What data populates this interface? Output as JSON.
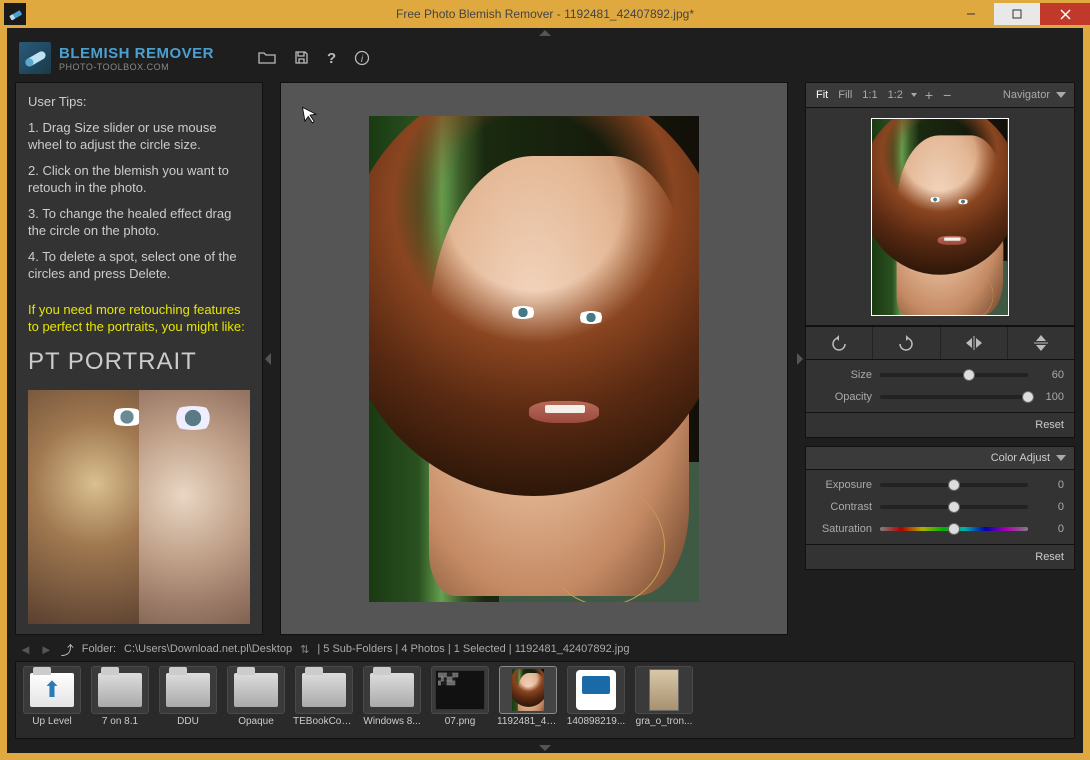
{
  "window": {
    "title": "Free Photo Blemish Remover - 1192481_42407892.jpg*"
  },
  "branding": {
    "name": "BLEMISH REMOVER",
    "sub": "PHOTO-TOOLBOX.COM"
  },
  "header_tools": {
    "open": "open-icon",
    "save": "save-icon",
    "help": "?",
    "info": "ⓘ"
  },
  "tips": {
    "heading": "User Tips:",
    "items": [
      "1. Drag Size slider or use mouse wheel to adjust the circle size.",
      "2. Click on the blemish you want to retouch in the photo.",
      "3. To change the healed effect drag the circle on the photo.",
      "4. To delete a spot, select one of the circles and press Delete."
    ],
    "promo_intro": "If you need more retouching features to perfect the portraits, you might like:",
    "promo_title": "PT PORTRAIT"
  },
  "navigator": {
    "title": "Navigator",
    "zoom_modes": [
      "Fit",
      "Fill",
      "1:1",
      "1:2"
    ],
    "active_mode": "Fit",
    "plus": "+",
    "minus": "−"
  },
  "tool_sliders": {
    "size": {
      "label": "Size",
      "value": 60,
      "min": 0,
      "max": 100
    },
    "opacity": {
      "label": "Opacity",
      "value": 100,
      "min": 0,
      "max": 100
    },
    "reset": "Reset"
  },
  "color_adjust": {
    "title": "Color Adjust",
    "exposure": {
      "label": "Exposure",
      "value": 0,
      "min": -100,
      "max": 100
    },
    "contrast": {
      "label": "Contrast",
      "value": 0,
      "min": -100,
      "max": 100
    },
    "saturation": {
      "label": "Saturation",
      "value": 0,
      "min": -100,
      "max": 100
    },
    "reset": "Reset"
  },
  "pathbar": {
    "folder_label": "Folder:",
    "path": "C:\\Users\\Download.net.pl\\Desktop",
    "summary": "| 5 Sub-Folders | 4 Photos | 1 Selected | 1192481_42407892.jpg"
  },
  "thumbnails": [
    {
      "label": "Up Level",
      "kind": "up"
    },
    {
      "label": "7 on 8.1",
      "kind": "folder"
    },
    {
      "label": "DDU",
      "kind": "folder"
    },
    {
      "label": "Opaque",
      "kind": "folder"
    },
    {
      "label": "TEBookCon...",
      "kind": "folder"
    },
    {
      "label": "Windows 8...",
      "kind": "folder"
    },
    {
      "label": "07.png",
      "kind": "image-dark"
    },
    {
      "label": "1192481_42...",
      "kind": "image-photo",
      "selected": true
    },
    {
      "label": "140898219...",
      "kind": "image-scanner"
    },
    {
      "label": "gra_o_tron...",
      "kind": "image-cover"
    }
  ]
}
